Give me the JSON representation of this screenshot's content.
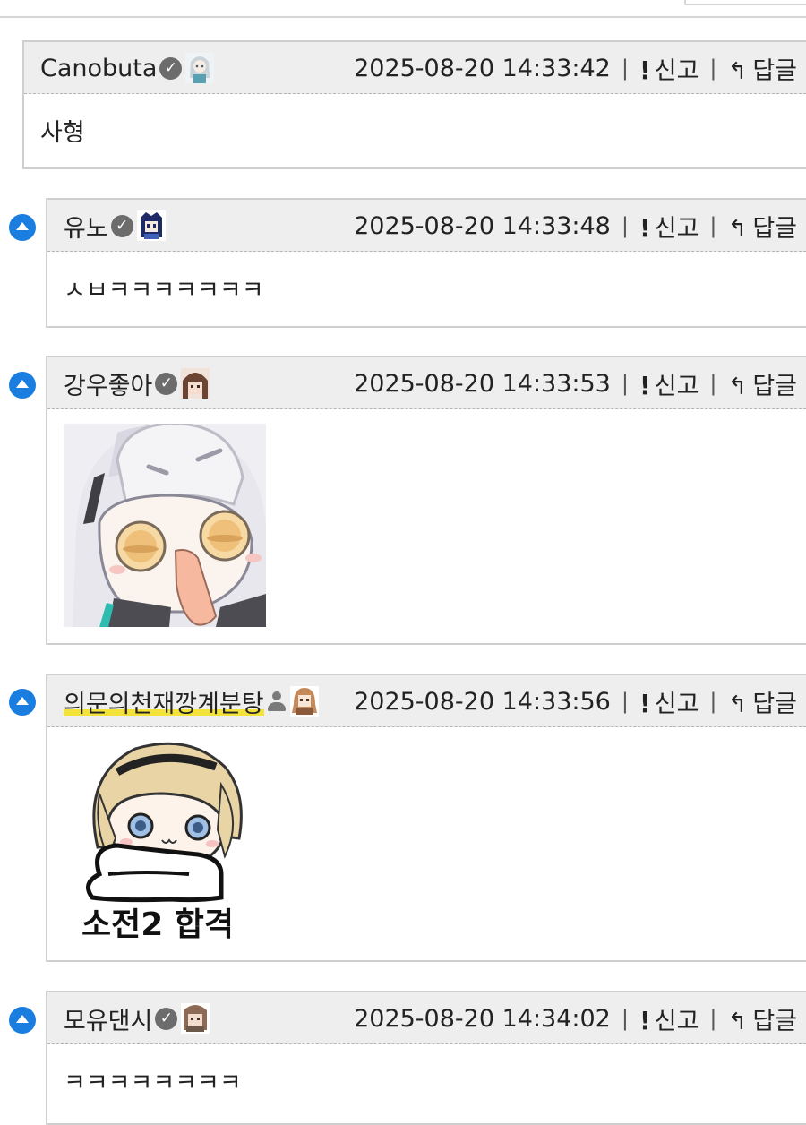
{
  "comments": [
    {
      "nick": "Canobuta",
      "time": "2025-08-20 14:33:42",
      "report": "신고",
      "reply": "답글",
      "body": "사형"
    },
    {
      "nick": "유노",
      "time": "2025-08-20 14:33:48",
      "report": "신고",
      "reply": "답글",
      "body": "ㅅㅂㅋㅋㅋㅋㅋㅋㅋ"
    },
    {
      "nick": "강우좋아",
      "time": "2025-08-20 14:33:53",
      "report": "신고",
      "reply": "답글",
      "image": "chibi-girl-dropped-jaw-sticker"
    },
    {
      "nick": "의문의천재깡계분탕",
      "time": "2025-08-20 14:33:56",
      "report": "신고",
      "reply": "답글",
      "image": "chibi-blonde-girl-sticker",
      "image_text": "소전2 합격"
    },
    {
      "nick": "모유댄시",
      "time": "2025-08-20 14:34:02",
      "report": "신고",
      "reply": "답글",
      "body": "ㅋㅋㅋㅋㅋㅋㅋㅋ"
    }
  ],
  "icons": {
    "verified": "check-badge-icon",
    "member": "person-icon",
    "report": "exclamation-icon",
    "reply": "reply-arrow-icon",
    "reply_indicator": "up-arrow-circle-icon"
  },
  "colors": {
    "accent": "#1a7ee0",
    "header_bg": "#eeeeee",
    "highlight": "#f3e23a"
  }
}
